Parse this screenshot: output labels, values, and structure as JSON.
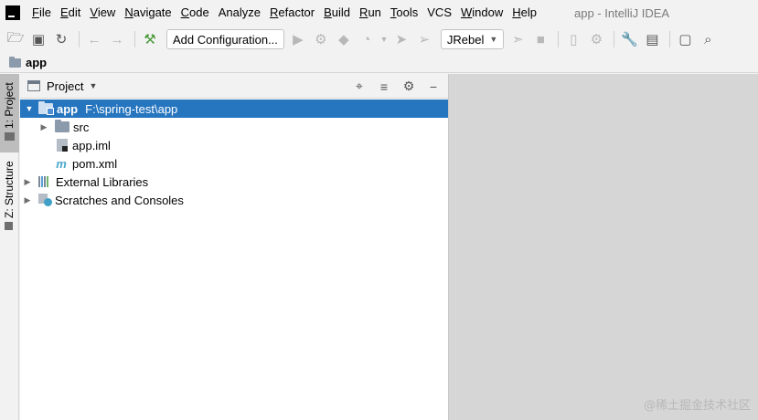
{
  "menubar": {
    "items": [
      {
        "first": "F",
        "rest": "ile"
      },
      {
        "first": "E",
        "rest": "dit"
      },
      {
        "first": "V",
        "rest": "iew"
      },
      {
        "first": "N",
        "rest": "avigate"
      },
      {
        "first": "C",
        "rest": "ode"
      },
      {
        "first": "",
        "rest": "Analyze"
      },
      {
        "first": "R",
        "rest": "efactor"
      },
      {
        "first": "B",
        "rest": "uild"
      },
      {
        "first": "R",
        "rest": "un"
      },
      {
        "first": "T",
        "rest": "ools"
      },
      {
        "first": "",
        "rest": "VCS"
      },
      {
        "first": "W",
        "rest": "indow"
      },
      {
        "first": "H",
        "rest": "elp"
      }
    ],
    "window_title": "app - IntelliJ IDEA"
  },
  "toolbar": {
    "run_config_label": "Add Configuration...",
    "jrebel_label": "JRebel"
  },
  "navbar": {
    "crumb": "app"
  },
  "left_strip": {
    "project_tab": "1: Project",
    "structure_tab": "Z: Structure"
  },
  "project_panel": {
    "title": "Project",
    "tree": {
      "root_name": "app",
      "root_path": "F:\\spring-test\\app",
      "src": "src",
      "iml": "app.iml",
      "pom": "pom.xml",
      "maven_glyph": "m",
      "external_libraries": "External Libraries",
      "scratches": "Scratches and Consoles"
    }
  },
  "editor": {
    "watermark": "@稀土掘金技术社区"
  }
}
